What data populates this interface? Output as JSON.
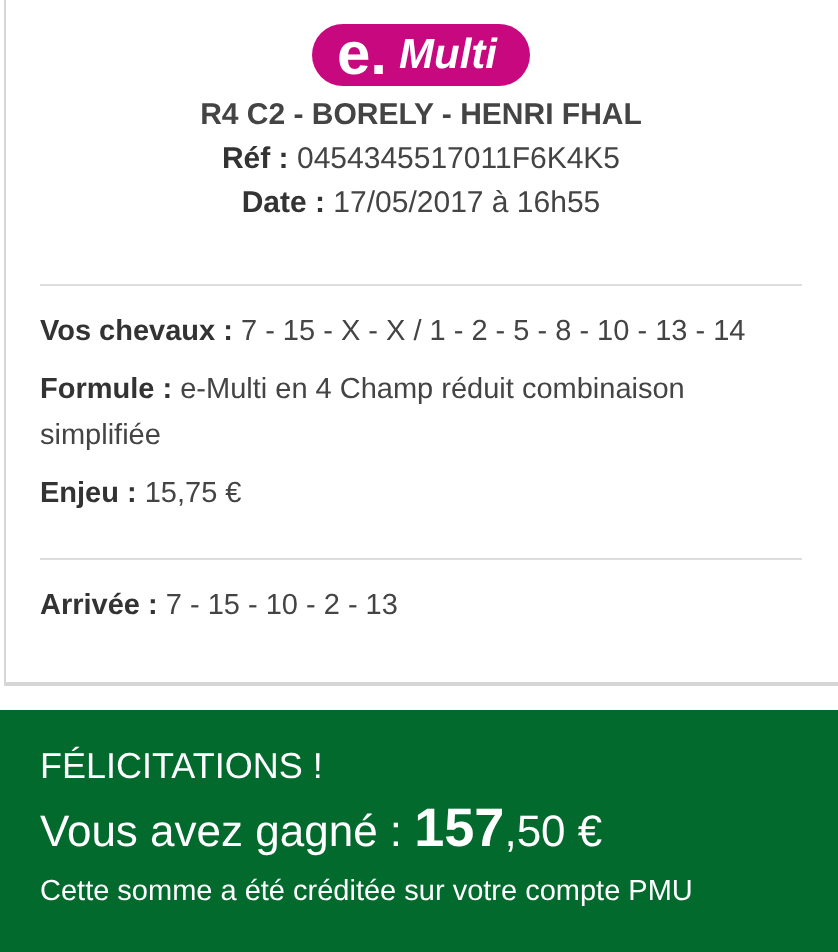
{
  "logo": {
    "mark": "e.",
    "name": "Multi"
  },
  "race": "R4 C2 - BORELY - HENRI FHAL",
  "ref": "**Réf :** 0454345517011F6K4K5",
  "date": "**Date :** 17/05/2017 à 16h55",
  "bet_details": [
    {
      "text": "**Vos chevaux :** 7 - 15 - X - X / 1 - 2 - 5 - 8 - 10 - 13 - 14"
    },
    {
      "text": "**Formule :** e-Multi en 4 Champ réduit combinaison simplifiée"
    },
    {
      "text": "**Enjeu :** 15,75 €"
    }
  ],
  "result": "**Arrivée :** 7 - 15 - 10 - 2 - 13",
  "win": {
    "title": "FÉLICITATIONS !",
    "amount": "Vous avez gagné : **157**,50 €",
    "note": "Cette somme a été créditée sur votre compte PMU"
  }
}
